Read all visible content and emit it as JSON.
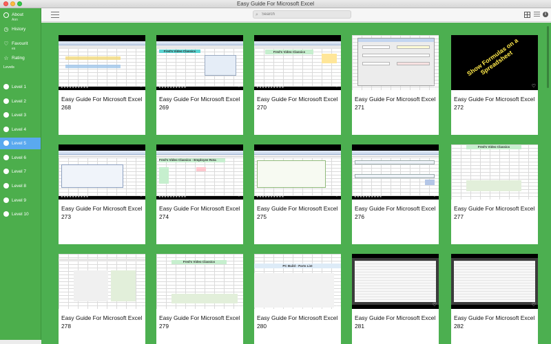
{
  "window": {
    "title": "Easy Guide For Microsoft Excel"
  },
  "toolbar": {
    "search_placeholder": "Search"
  },
  "sidebar": {
    "about": {
      "label": "About",
      "sub": "Ann"
    },
    "history": {
      "label": "History"
    },
    "favourites": {
      "label": "Favourit",
      "sub": "es"
    },
    "rating": {
      "label": "Rating"
    },
    "levels_heading": "Levels",
    "levels": [
      "Level 1",
      "Level 2",
      "Level 3",
      "Level 4",
      "Level 5",
      "Level 6",
      "Level 7",
      "Level 8",
      "Level 9",
      "Level 10"
    ],
    "active_level": "Level 5"
  },
  "thumbnail_text": {
    "videos_title": "Fred's Video Classics",
    "employee_title": "Fred's Video Classics - Employee Rota",
    "banner": "Show Formulas on a Spreadsheet",
    "parts_title": "PC Build - Parts List"
  },
  "cards": [
    {
      "title": "Easy Guide For Microsoft Excel",
      "number": "268"
    },
    {
      "title": "Easy Guide For Microsoft Excel",
      "number": "269"
    },
    {
      "title": "Easy Guide For Microsoft Excel",
      "number": "270"
    },
    {
      "title": "Easy Guide For Microsoft Excel",
      "number": "271"
    },
    {
      "title": "Easy Guide For Microsoft Excel",
      "number": "272"
    },
    {
      "title": "Easy Guide For Microsoft Excel",
      "number": "273"
    },
    {
      "title": "Easy Guide For Microsoft Excel",
      "number": "274"
    },
    {
      "title": "Easy Guide For Microsoft Excel",
      "number": "275"
    },
    {
      "title": "Easy Guide For Microsoft Excel",
      "number": "276"
    },
    {
      "title": "Easy Guide For Microsoft Excel",
      "number": "277"
    },
    {
      "title": "Easy Guide For Microsoft Excel",
      "number": "278"
    },
    {
      "title": "Easy Guide For Microsoft Excel",
      "number": "279"
    },
    {
      "title": "Easy Guide For Microsoft Excel",
      "number": "280"
    },
    {
      "title": "Easy Guide For Microsoft Excel",
      "number": "281"
    },
    {
      "title": "Easy Guide For Microsoft Excel",
      "number": "282"
    }
  ],
  "colors": {
    "sidebar": "#4cae4c",
    "content": "#4caf50",
    "active": "#5aa9ef"
  }
}
